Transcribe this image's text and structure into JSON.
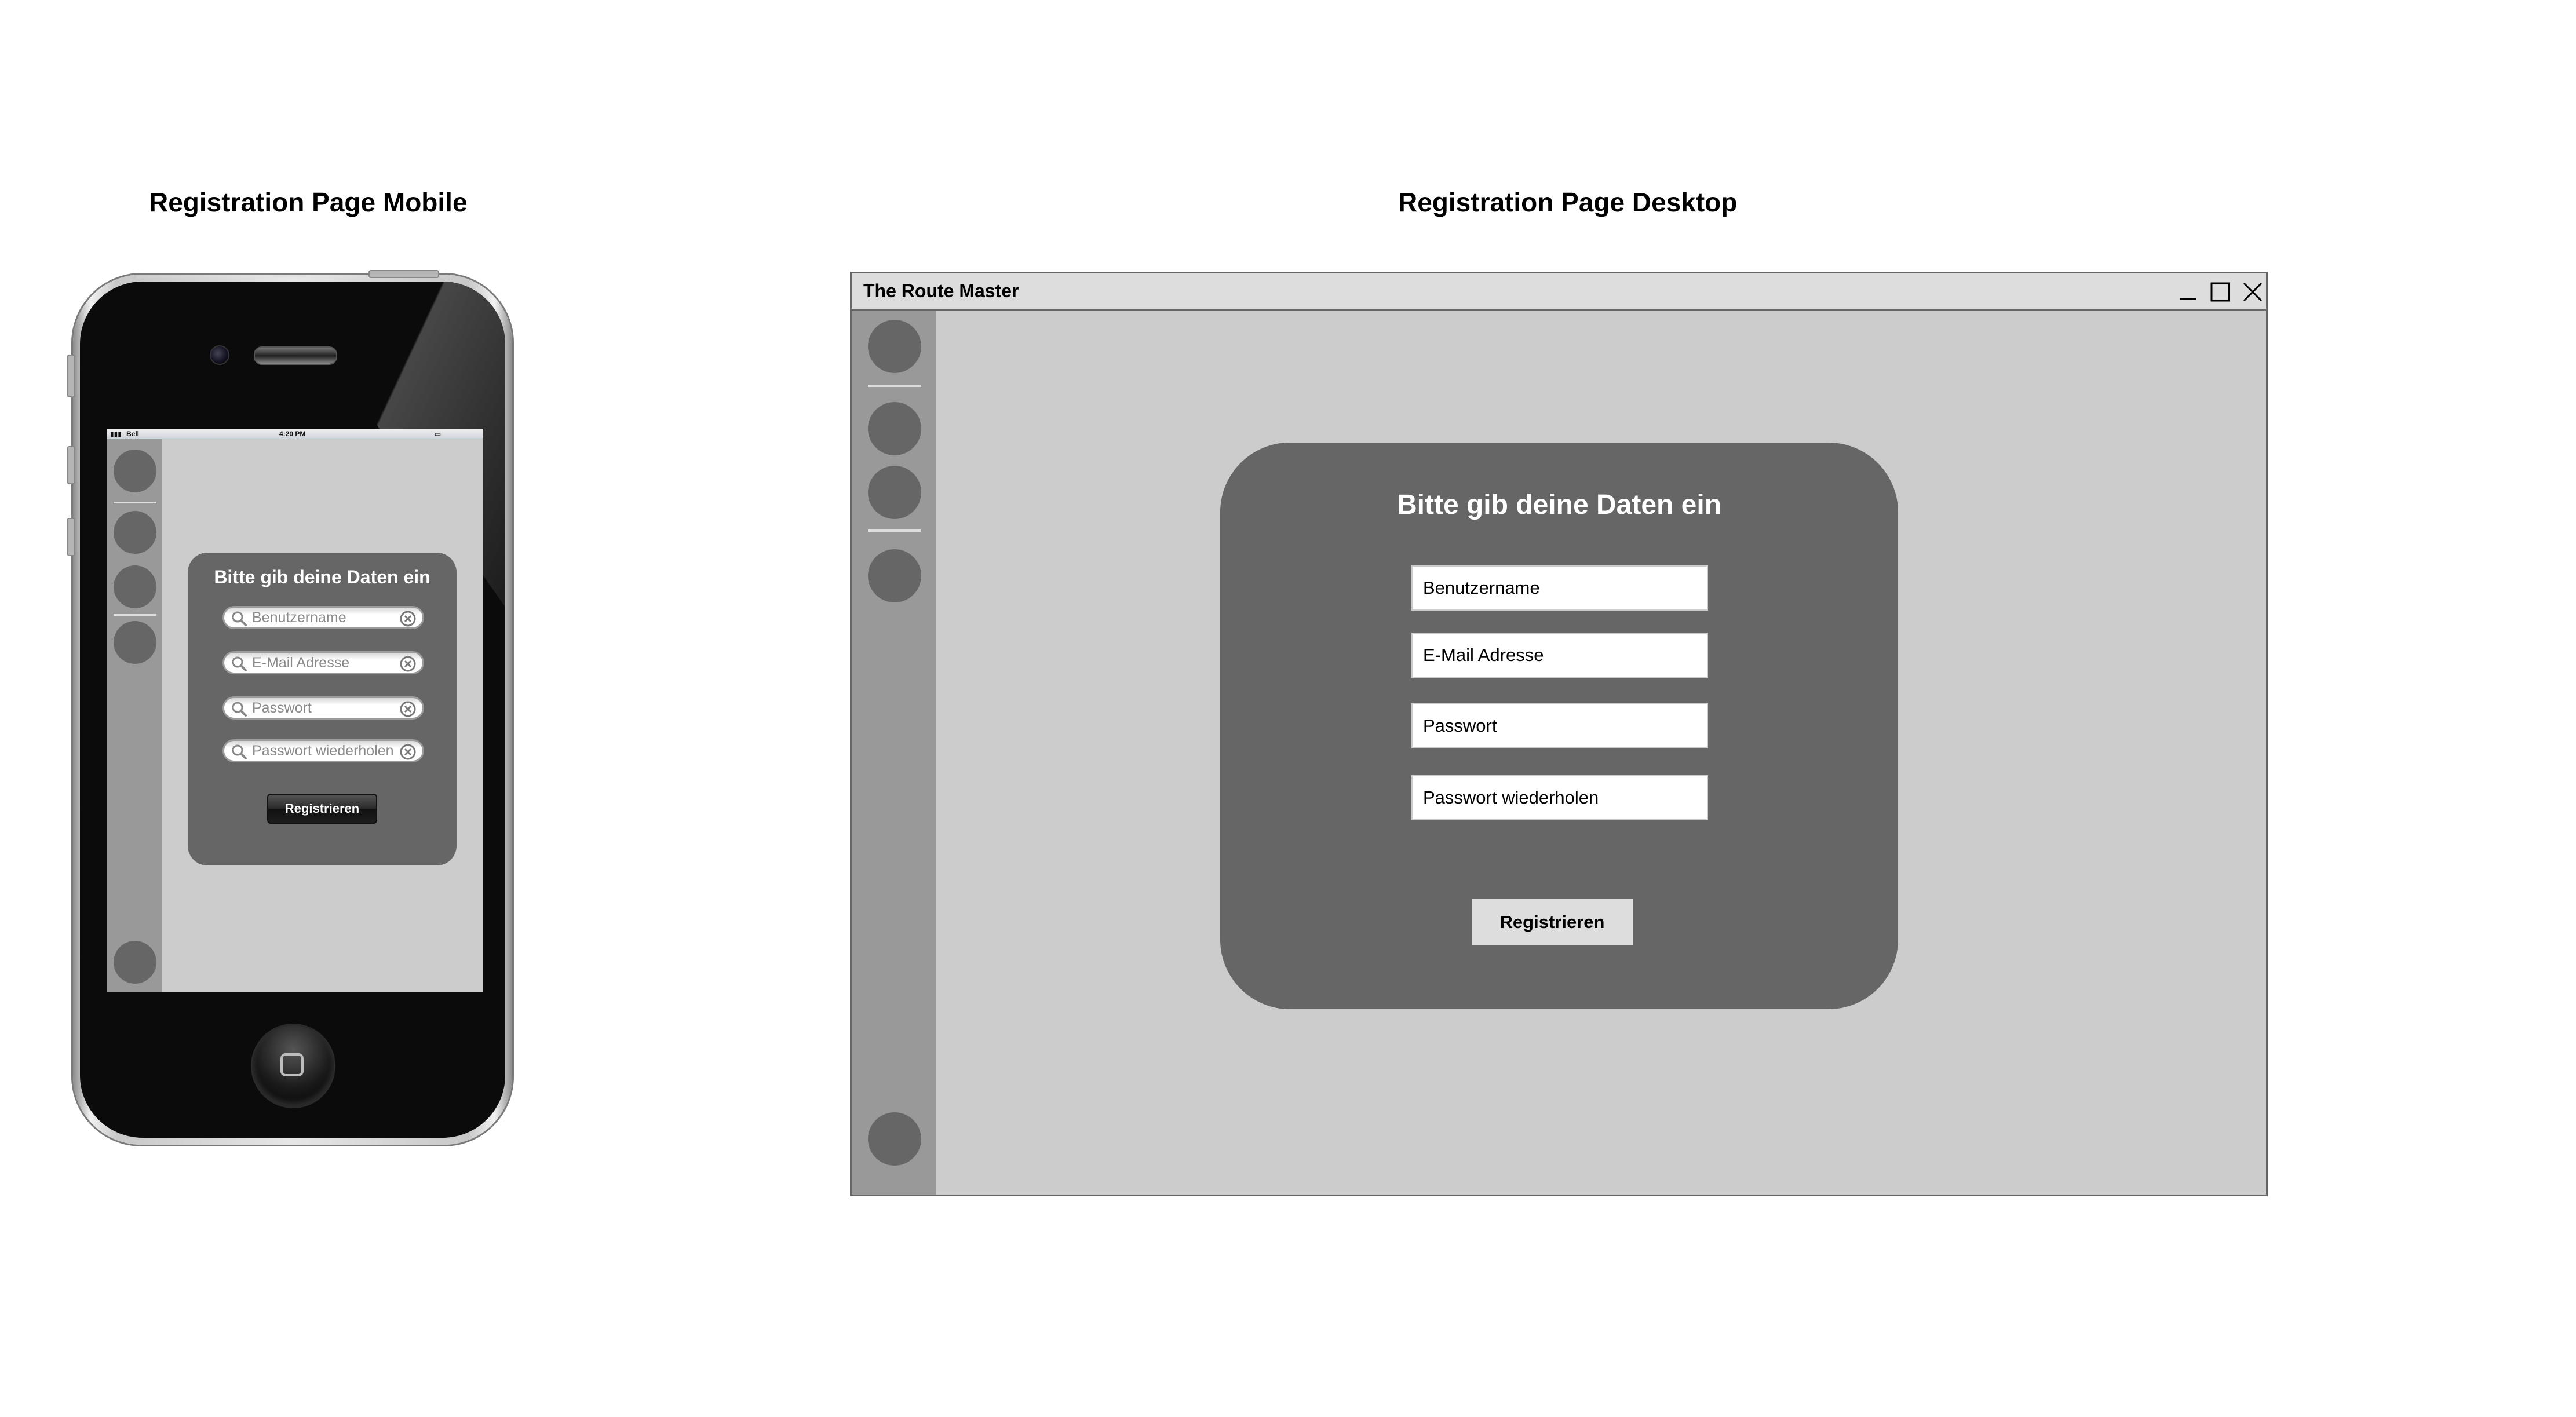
{
  "mobile": {
    "section_title": "Registration Page Mobile",
    "status_bar": {
      "carrier": "Bell",
      "time": "4:20 PM"
    },
    "card_title": "Bitte gib deine Daten ein",
    "fields": [
      {
        "placeholder": "Benutzername"
      },
      {
        "placeholder": "E-Mail Adresse"
      },
      {
        "placeholder": "Passwort"
      },
      {
        "placeholder": "Passwort wiederholen"
      }
    ],
    "register_button": "Registrieren"
  },
  "desktop": {
    "section_title": "Registration Page Desktop",
    "window_title": "The Route Master",
    "card_title": "Bitte gib deine Daten ein",
    "fields": [
      {
        "placeholder": "Benutzername"
      },
      {
        "placeholder": "E-Mail Adresse"
      },
      {
        "placeholder": "Passwort"
      },
      {
        "placeholder": "Passwort wiederholen"
      }
    ],
    "register_button": "Registrieren"
  },
  "icons": {
    "window_controls": [
      "minimize-icon",
      "maximize-icon",
      "close-icon"
    ],
    "field_icons": [
      "search-icon",
      "clear-icon"
    ]
  },
  "colors": {
    "sidebar": "#999999",
    "content_bg": "#cccccc",
    "card_bg": "#666666",
    "nav_circle": "#666666",
    "titlebar": "#dddddd"
  }
}
